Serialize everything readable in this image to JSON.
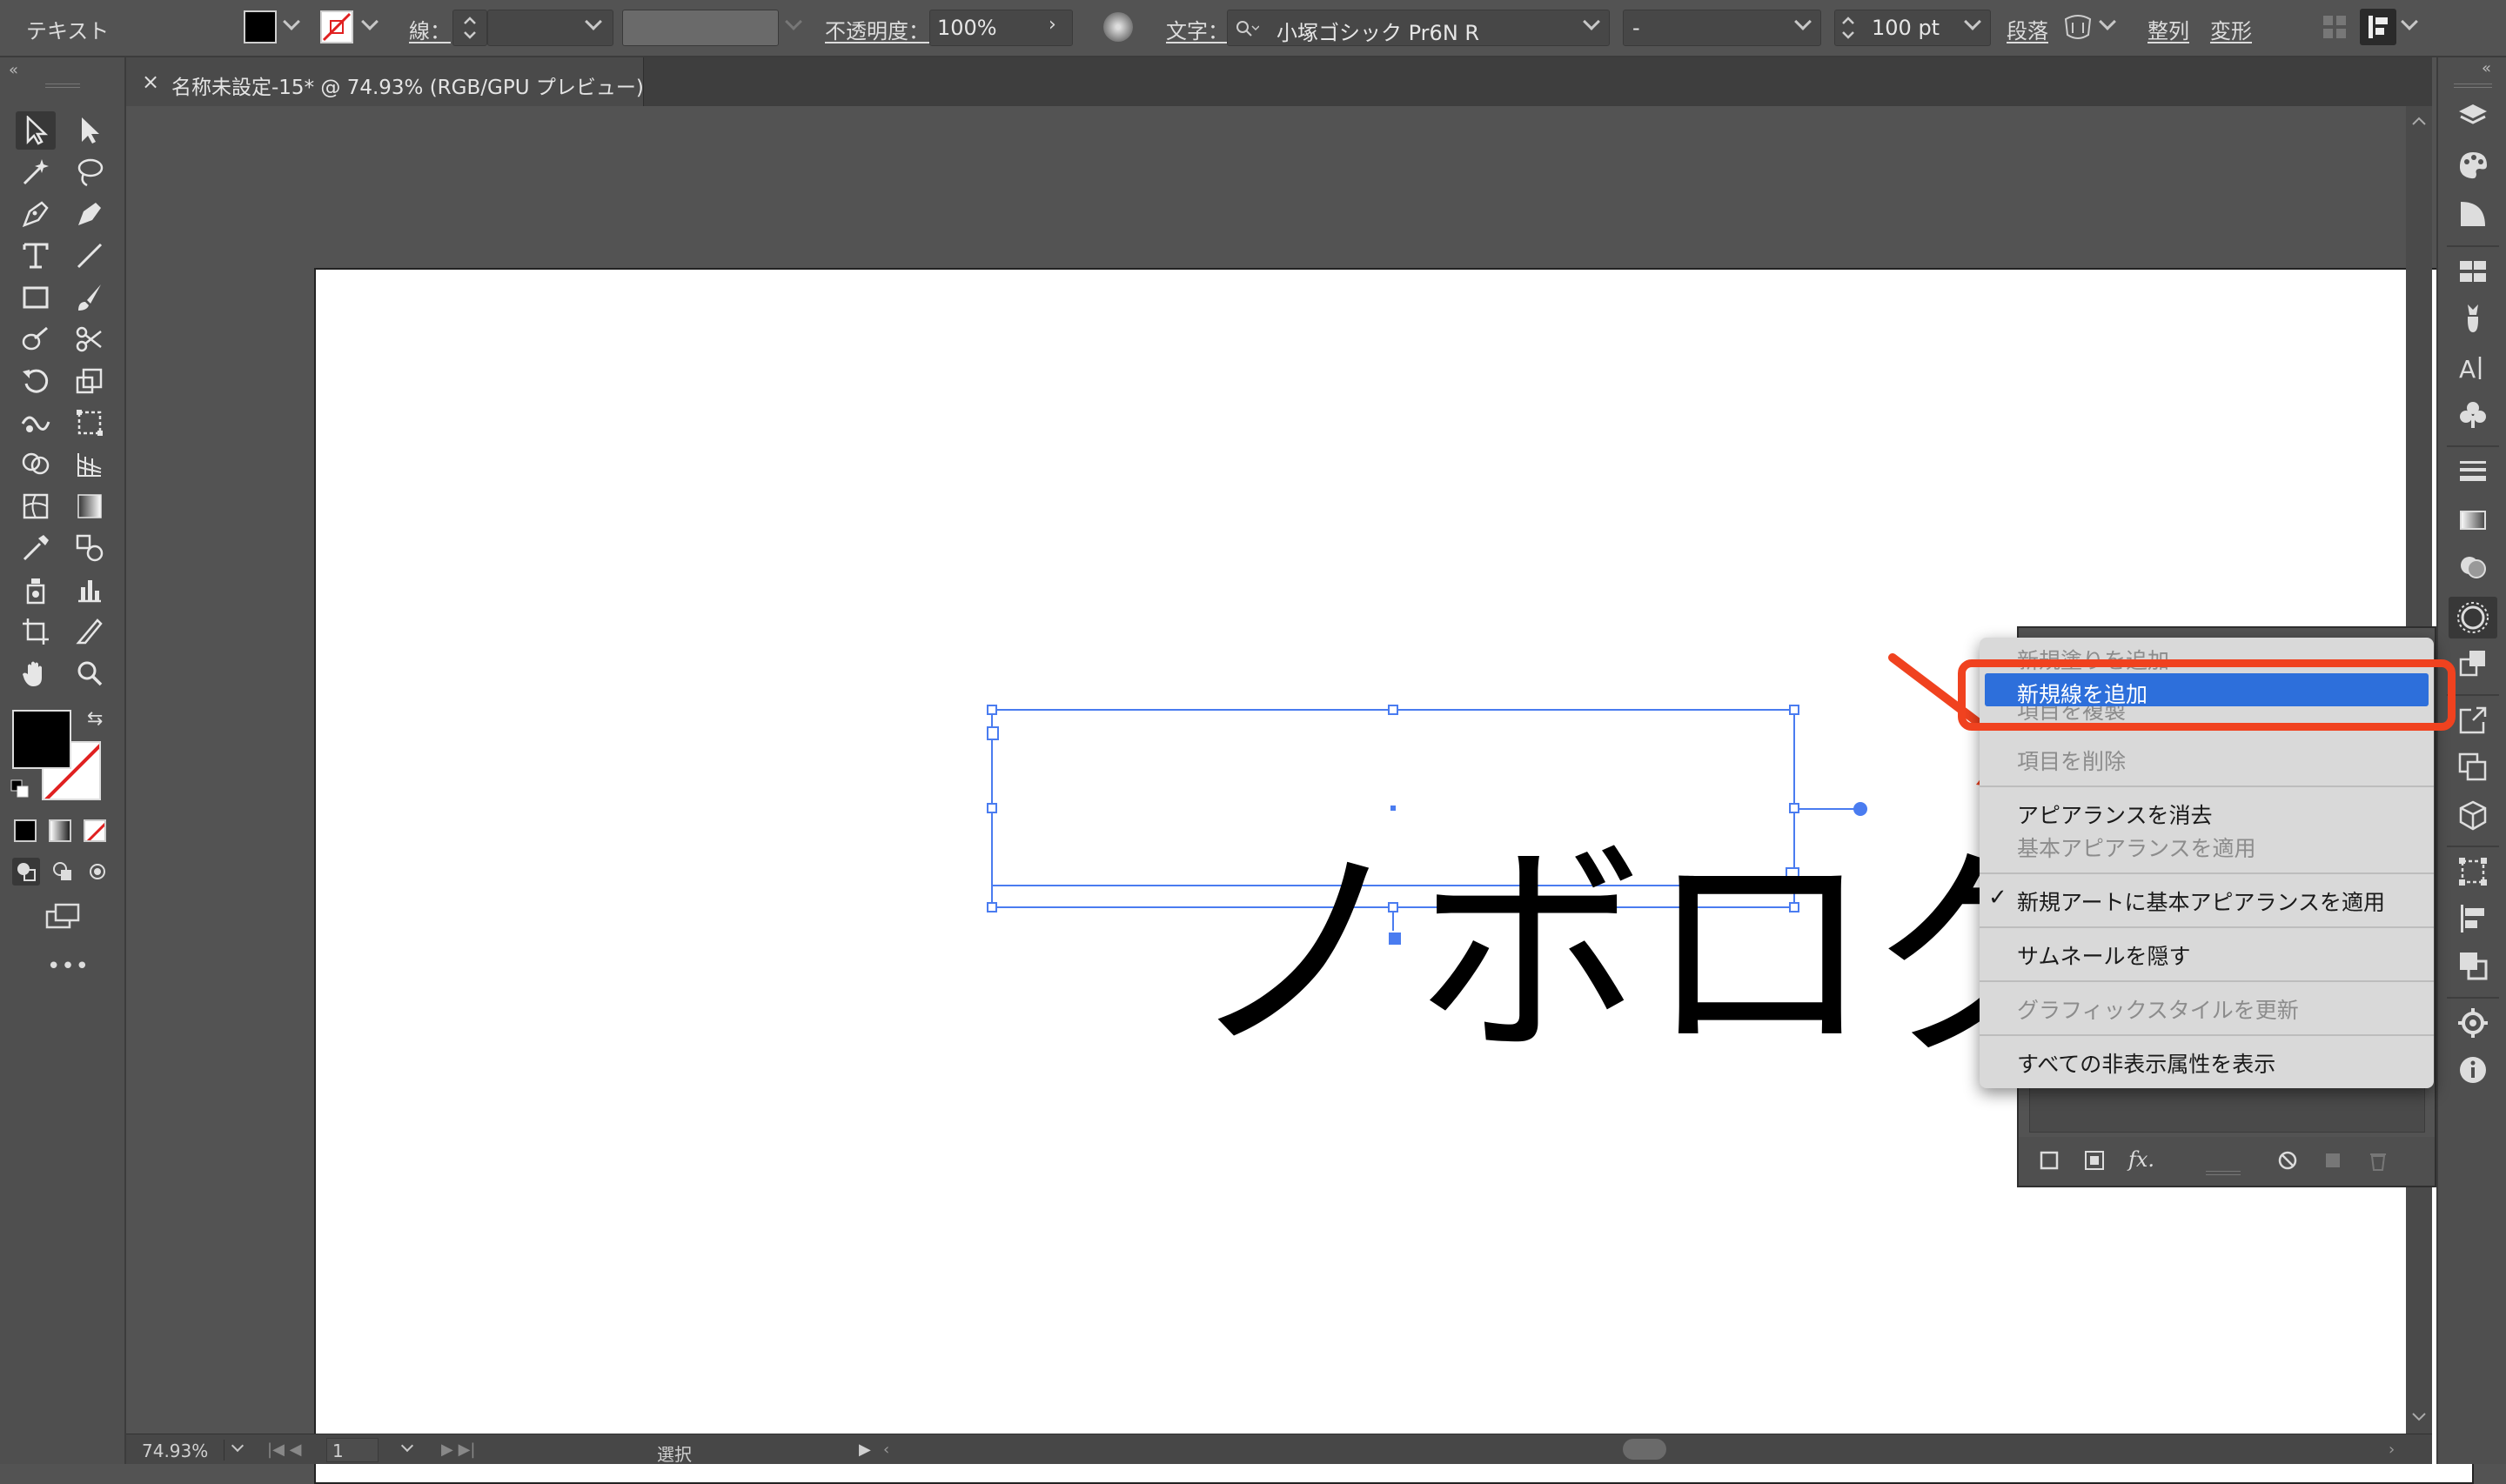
{
  "control_bar": {
    "mode_label": "テキスト",
    "stroke_label": "線：",
    "opacity_label": "不透明度：",
    "opacity_value": "100%",
    "character_label": "文字：",
    "font_family": "小塚ゴシック Pr6N R",
    "font_style": "-",
    "font_size": "100 pt",
    "paragraph_label": "段落",
    "align_label": "整列",
    "transform_label": "変形"
  },
  "document_tab": {
    "close_icon": "×",
    "title": "名称未設定-15* @ 74.93% (RGB/GPU プレビュー)"
  },
  "artboard": {
    "text": "ノボログ"
  },
  "context_menu": {
    "items": [
      {
        "label": "新規塗りを追加",
        "enabled": false
      },
      {
        "label": "新規線を追加",
        "enabled": true,
        "highlighted": true
      },
      {
        "label": "項目を複製",
        "enabled": false
      },
      {
        "label": "項目を削除",
        "enabled": false
      },
      {
        "label": "アピアランスを消去",
        "enabled": true
      },
      {
        "label": "基本アピアランスを適用",
        "enabled": false
      },
      {
        "label": "新規アートに基本アピアランスを適用",
        "enabled": true,
        "checked": true,
        "check_mark": "✓"
      },
      {
        "label": "サムネールを隠す",
        "enabled": true
      },
      {
        "label": "グラフィックスタイルを更新",
        "enabled": false
      },
      {
        "label": "すべての非表示属性を表示",
        "enabled": true
      }
    ]
  },
  "status_bar": {
    "zoom": "74.93%",
    "artboard_number": "1",
    "tool_status": "選択"
  },
  "colors": {
    "accent_highlight": "#2d6fdb",
    "annotation_red": "#f0421f",
    "selection_blue": "#4a7cf0",
    "ui_background": "#535353"
  },
  "icons": {
    "fx_label": "fx."
  }
}
